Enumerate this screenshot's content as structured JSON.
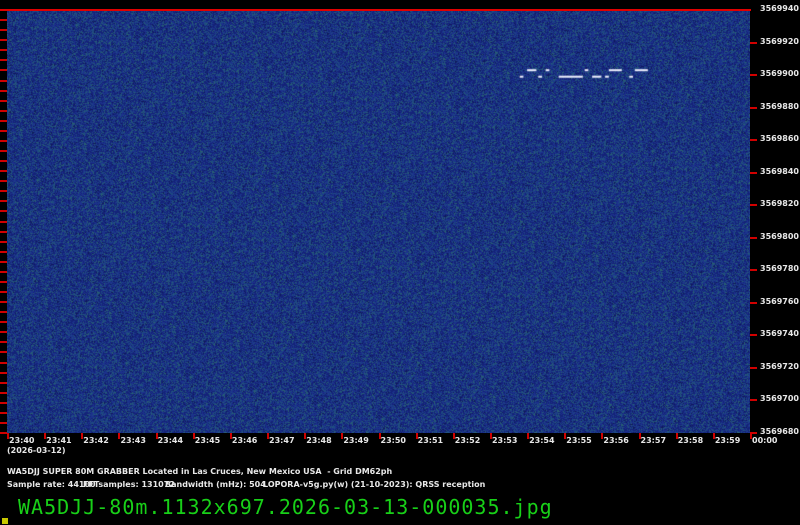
{
  "chart_data": {
    "type": "heatmap",
    "title": "WA5DJJ SUPER 80M GRABBER Located in Las Cruces, New Mexico USA - Grid DM62ph",
    "date_label": "(2026-03-12)",
    "x_ticks": [
      "23:40",
      "23:41",
      "23:42",
      "23:43",
      "23:44",
      "23:45",
      "23:46",
      "23:47",
      "23:48",
      "23:49",
      "23:50",
      "23:51",
      "23:52",
      "23:53",
      "23:54",
      "23:55",
      "23:56",
      "23:57",
      "23:58",
      "23:59",
      "00:00"
    ],
    "y_ticks": [
      "3569940",
      "3569920",
      "3569900",
      "3569880",
      "3569860",
      "3569840",
      "3569820",
      "3569800",
      "3569780",
      "3569760",
      "3569740",
      "3569720",
      "3569700",
      "3569680"
    ],
    "ylim": [
      3569680,
      3569940
    ],
    "xlim_minutes": [
      0,
      20
    ],
    "signal": {
      "description_freqs_hz": [
        3569903,
        3569899
      ],
      "segments": [
        {
          "t": [
            13.8,
            13.9
          ],
          "f": 3569899
        },
        {
          "t": [
            14.0,
            14.25
          ],
          "f": 3569903
        },
        {
          "t": [
            14.3,
            14.4
          ],
          "f": 3569899
        },
        {
          "t": [
            14.5,
            14.6
          ],
          "f": 3569903
        },
        {
          "t": [
            14.85,
            15.5
          ],
          "f": 3569899
        },
        {
          "t": [
            15.55,
            15.65
          ],
          "f": 3569903
        },
        {
          "t": [
            15.75,
            16.0
          ],
          "f": 3569899
        },
        {
          "t": [
            16.1,
            16.2
          ],
          "f": 3569899
        },
        {
          "t": [
            16.2,
            16.55
          ],
          "f": 3569903
        },
        {
          "t": [
            16.75,
            16.85
          ],
          "f": 3569899
        },
        {
          "t": [
            16.9,
            17.25
          ],
          "f": 3569903
        }
      ]
    },
    "colors": {
      "background": "#1c2f86",
      "signal": "#f0f0ff",
      "marker": "#e00000"
    }
  },
  "info": {
    "line1": "WA5DJJ SUPER 80M GRABBER Located in Las Cruces, New Mexico USA  - Grid DM62ph",
    "sample_rate": "Sample rate: 44100",
    "fft": "FFTsamples: 131072",
    "bandwidth": "Bandwidth (mHz): 504",
    "software": "LOPORA-v5g.py(w) (21-10-2023): QRSS reception"
  },
  "filename": "WA5DJJ-80m.1132x697.2026-03-13-000035.jpg"
}
